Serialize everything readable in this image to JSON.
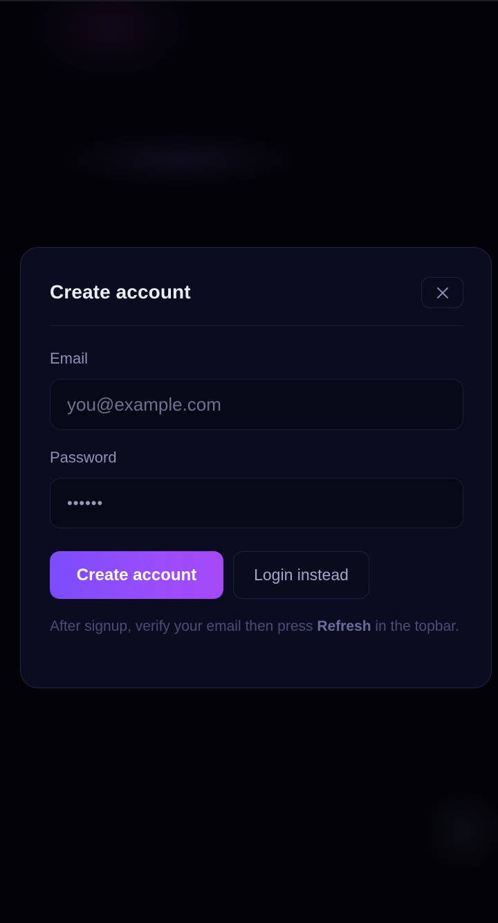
{
  "modal": {
    "title": "Create account",
    "close_icon": "close-icon",
    "email": {
      "label": "Email",
      "placeholder": "you@example.com",
      "value": ""
    },
    "password": {
      "label": "Password",
      "masked_value": "••••••"
    },
    "primary_button": "Create account",
    "secondary_button": "Login instead",
    "helper": {
      "before": "After signup, verify your email then press ",
      "emphasis": "Refresh",
      "after": " in the topbar."
    }
  },
  "colors": {
    "background": "#020207",
    "modal_background": "#0b0c1f",
    "accent_start": "#7b4cff",
    "accent_end": "#a449f5"
  }
}
